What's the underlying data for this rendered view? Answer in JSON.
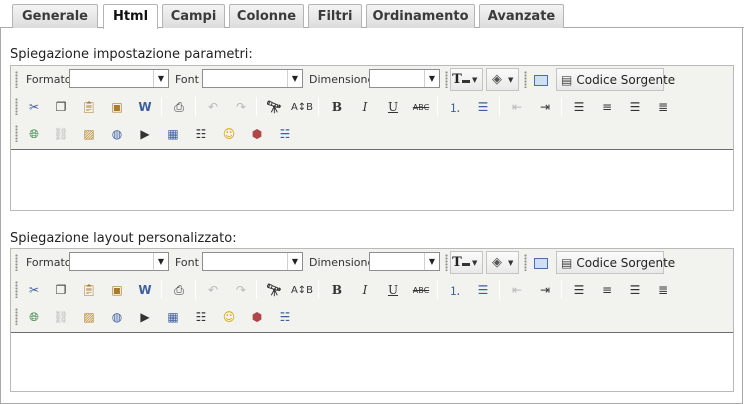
{
  "tabs": [
    {
      "label": "Generale",
      "active": false
    },
    {
      "label": "Html",
      "active": true
    },
    {
      "label": "Campi",
      "active": false
    },
    {
      "label": "Colonne",
      "active": false
    },
    {
      "label": "Filtri",
      "active": false
    },
    {
      "label": "Ordinamento",
      "active": false
    },
    {
      "label": "Avanzate",
      "active": false
    }
  ],
  "sections": [
    {
      "label": "Spiegazione impostazione parametri:",
      "content": ""
    },
    {
      "label": "Spiegazione layout personalizzato:",
      "content": ""
    }
  ],
  "toolbar": {
    "format_label": "Formato",
    "font_label": "Font",
    "size_label": "Dimensione",
    "format_value": "",
    "font_value": "",
    "size_value": "",
    "source_label": "Codice Sorgente",
    "bold_glyph": "B",
    "italic_glyph": "I",
    "underline_glyph": "U",
    "strike_glyph": "ABC"
  },
  "colors": {
    "accent_orange": "#e8a33b",
    "link_blue": "#2c5fa8",
    "toolbar_bg": "#f2f2ef",
    "tab_active_bg": "#ffffff"
  }
}
